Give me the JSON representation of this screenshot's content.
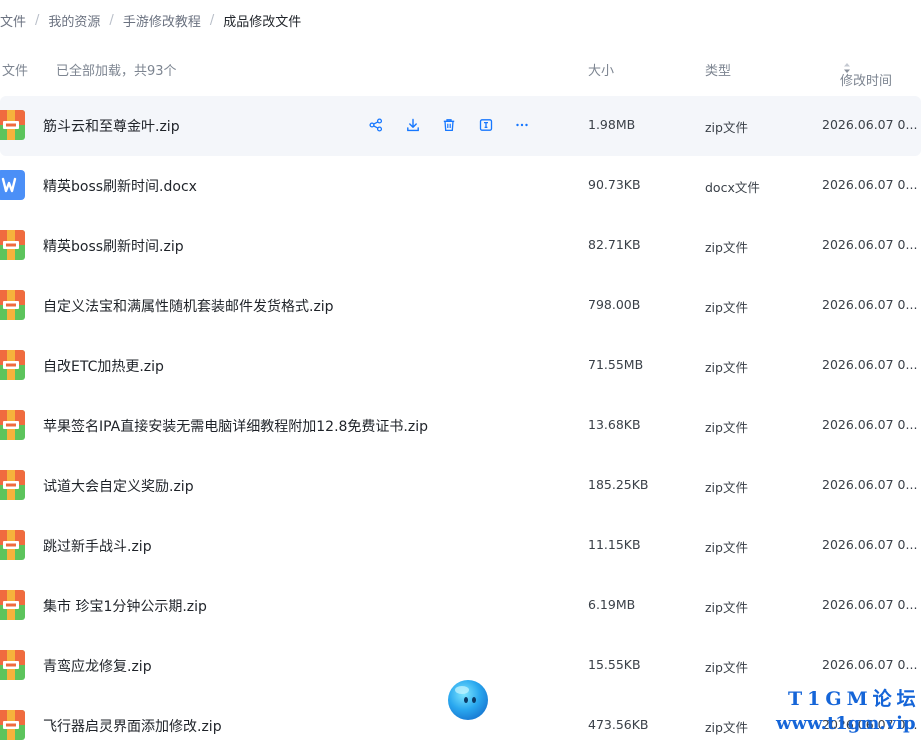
{
  "breadcrumb": {
    "items": [
      "文件",
      "我的资源",
      "手游修改教程",
      "成品修改文件"
    ],
    "separator": "/"
  },
  "list_header": {
    "file": "文件",
    "loaded": "已全部加载，共93个",
    "size": "大小",
    "type": "类型",
    "mtime": "修改时间"
  },
  "files": [
    {
      "name": "筋斗云和至尊金叶.zip",
      "size": "1.98MB",
      "type": "zip文件",
      "mtime": "2026.06.07 0...",
      "icon": "zip-icon"
    },
    {
      "name": "精英boss刷新时间.docx",
      "size": "90.73KB",
      "type": "docx文件",
      "mtime": "2026.06.07 0...",
      "icon": "docx-icon"
    },
    {
      "name": "精英boss刷新时间.zip",
      "size": "82.71KB",
      "type": "zip文件",
      "mtime": "2026.06.07 0...",
      "icon": "zip-icon"
    },
    {
      "name": "自定义法宝和满属性随机套装邮件发货格式.zip",
      "size": "798.00B",
      "type": "zip文件",
      "mtime": "2026.06.07 0...",
      "icon": "zip-icon"
    },
    {
      "name": "自改ETC加热更.zip",
      "size": "71.55MB",
      "type": "zip文件",
      "mtime": "2026.06.07 0...",
      "icon": "zip-icon"
    },
    {
      "name": "苹果签名IPA直接安装无需电脑详细教程附加12.8免费证书.zip",
      "size": "13.68KB",
      "type": "zip文件",
      "mtime": "2026.06.07 0...",
      "icon": "zip-icon"
    },
    {
      "name": "试道大会自定义奖励.zip",
      "size": "185.25KB",
      "type": "zip文件",
      "mtime": "2026.06.07 0...",
      "icon": "zip-icon"
    },
    {
      "name": "跳过新手战斗.zip",
      "size": "11.15KB",
      "type": "zip文件",
      "mtime": "2026.06.07 0...",
      "icon": "zip-icon"
    },
    {
      "name": "集市 珍宝1分钟公示期.zip",
      "size": "6.19MB",
      "type": "zip文件",
      "mtime": "2026.06.07 0...",
      "icon": "zip-icon"
    },
    {
      "name": "青鸾应龙修复.zip",
      "size": "15.55KB",
      "type": "zip文件",
      "mtime": "2026.06.07 0...",
      "icon": "zip-icon"
    },
    {
      "name": "飞行器启灵界面添加修改.zip",
      "size": "473.56KB",
      "type": "zip文件",
      "mtime": "2026.06.07 0...",
      "icon": "zip-icon"
    }
  ],
  "hovered_row": 0,
  "row_actions": [
    "share-icon",
    "download-icon",
    "delete-icon",
    "rename-icon",
    "more-icon"
  ],
  "watermark": {
    "line1": "T1GM论坛",
    "line2": "www.t1gm.vip"
  },
  "colors": {
    "accent": "#1677ff",
    "hover_bg": "#f4f6fa",
    "zip_top": "#f06b3f",
    "zip_bottom": "#5cc45c",
    "docx": "#4b8ff7",
    "watermark": "#1565d8"
  }
}
